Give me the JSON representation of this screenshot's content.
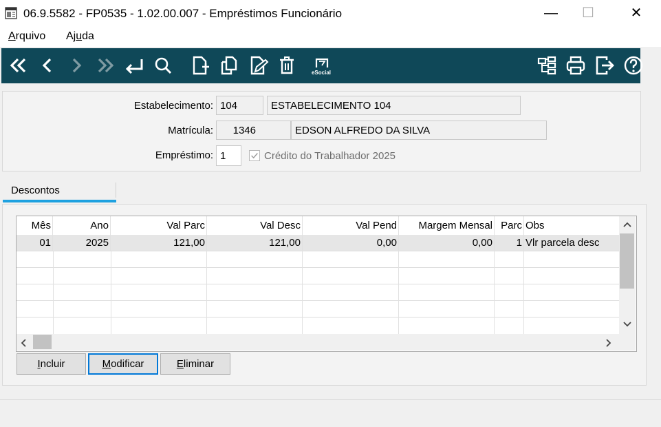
{
  "window": {
    "title": "06.9.5582 - FP0535 - 1.02.00.007 - Empréstimos Funcionário",
    "minimize_glyph": "—",
    "maximize_glyph": "☐",
    "close_glyph": "✕"
  },
  "menu": {
    "arquivo_before": "",
    "arquivo_key": "A",
    "arquivo_after": "rquivo",
    "ajuda_before": "Aj",
    "ajuda_key": "u",
    "ajuda_after": "da"
  },
  "toolbar": {
    "background": "#0f4858",
    "buttons": [
      "first-record-icon",
      "previous-record-icon",
      "next-record-icon",
      "last-record-icon",
      "return-icon",
      "search-icon",
      "new-document-icon",
      "copy-icon",
      "edit-document-icon",
      "delete-icon",
      "esocial-icon",
      "hierarchy-icon",
      "print-icon",
      "exit-icon",
      "help-icon"
    ],
    "esocial_text": "eSocial"
  },
  "form": {
    "estabelecimento_label": "Estabelecimento:",
    "estabelecimento_code": "104",
    "estabelecimento_name": "ESTABELECIMENTO 104",
    "matricula_label": "Matrícula:",
    "matricula_code": "1346",
    "matricula_name": "EDSON ALFREDO DA SILVA",
    "emprestimo_label": "Empréstimo:",
    "emprestimo_value": "1",
    "credito_label": "Crédito do Trabalhador 2025",
    "credito_checked": true
  },
  "tabs": {
    "descontos": "Descontos",
    "accent": "#1ea1e0"
  },
  "grid": {
    "columns": [
      "Mês",
      "Ano",
      "Val Parc",
      "Val Desc",
      "Val Pend",
      "Margem Mensal",
      "Parc",
      "Obs"
    ],
    "rows": [
      [
        "01",
        "2025",
        "121,00",
        "121,00",
        "0,00",
        "0,00",
        "1",
        "Vlr parcela desc"
      ]
    ],
    "selected_row_color": "#e6e6e6"
  },
  "buttons": {
    "incluir_key": "I",
    "incluir_rest": "ncluir",
    "modificar_key": "M",
    "modificar_rest": "odificar",
    "eliminar_key": "E",
    "eliminar_rest": "liminar"
  }
}
